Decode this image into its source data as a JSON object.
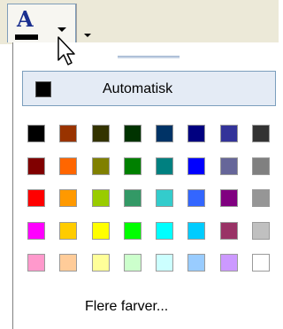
{
  "automatic": {
    "label": "Automatisk"
  },
  "more_colors": {
    "label": "Flere farver..."
  },
  "swatches": [
    [
      "#000000",
      "#993300",
      "#333300",
      "#003300",
      "#003366",
      "#000080",
      "#333399",
      "#333333"
    ],
    [
      "#800000",
      "#FF6600",
      "#808000",
      "#008000",
      "#008080",
      "#0000FF",
      "#666699",
      "#808080"
    ],
    [
      "#FF0000",
      "#FF9900",
      "#99CC00",
      "#339966",
      "#33CCCC",
      "#3366FF",
      "#800080",
      "#969696"
    ],
    [
      "#FF00FF",
      "#FFCC00",
      "#FFFF00",
      "#00FF00",
      "#00FFFF",
      "#00CCFF",
      "#993366",
      "#C0C0C0"
    ],
    [
      "#FF99CC",
      "#FFCC99",
      "#FFFF99",
      "#CCFFCC",
      "#CCFFFF",
      "#99CCFF",
      "#CC99FF",
      "#FFFFFF"
    ]
  ],
  "icons": {
    "font_color": "font-color-icon",
    "dropdown": "chevron-down-icon",
    "cursor": "mouse-pointer-icon"
  },
  "colors": {
    "font_a": "#1a2f8f",
    "current_color": "#000000",
    "auto_highlight": "#e4ebf5"
  }
}
